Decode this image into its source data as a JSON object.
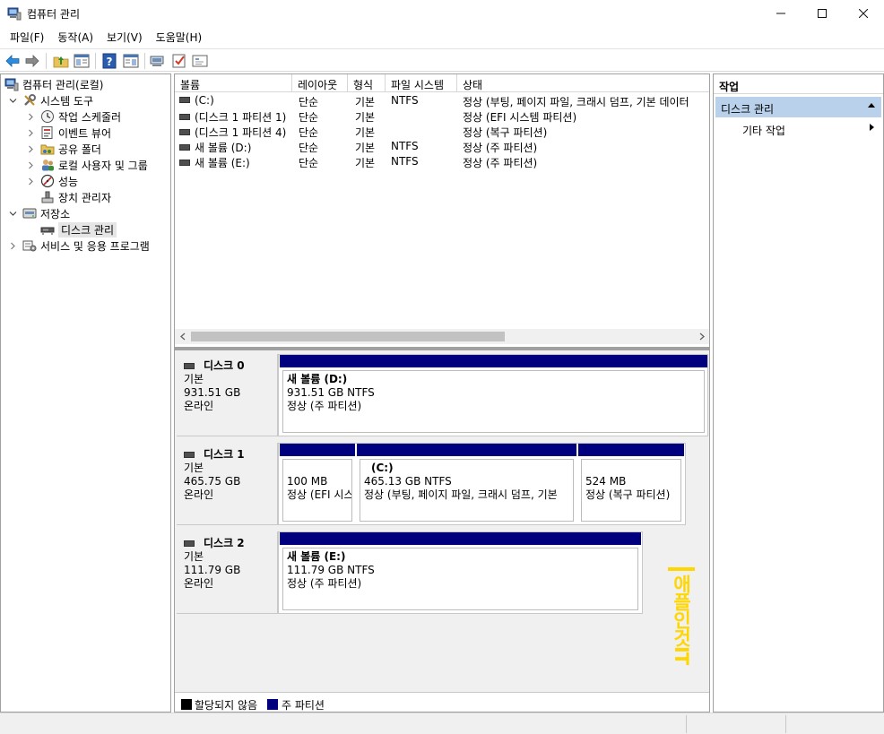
{
  "window": {
    "title": "컴퓨터 관리"
  },
  "menu": [
    {
      "label": "파일(F)"
    },
    {
      "label": "동작(A)"
    },
    {
      "label": "보기(V)"
    },
    {
      "label": "도움말(H)"
    }
  ],
  "toolbar": {
    "icons": [
      "back-icon",
      "forward-icon",
      "up-folder-icon",
      "show-hide-tree-icon",
      "help-icon",
      "properties-icon",
      "connect-icon",
      "check-icon",
      "console-icon"
    ]
  },
  "tree": {
    "root": "컴퓨터 관리(로컬)",
    "system_tools": "시스템 도구",
    "task_scheduler": "작업 스케줄러",
    "event_viewer": "이벤트 뷰어",
    "shared_folders": "공유 폴더",
    "local_users": "로컬 사용자 및 그룹",
    "performance": "성능",
    "device_manager": "장치 관리자",
    "storage": "저장소",
    "disk_management": "디스크 관리",
    "services": "서비스 및 응용 프로그램"
  },
  "volumes": {
    "headers": [
      "볼륨",
      "레이아웃",
      "형식",
      "파일 시스템",
      "상태"
    ],
    "rows": [
      {
        "volume": "(C:)",
        "layout": "단순",
        "type": "기본",
        "fs": "NTFS",
        "status": "정상 (부팅, 페이지 파일, 크래시 덤프, 기본 데이터"
      },
      {
        "volume": "(디스크 1 파티션 1)",
        "layout": "단순",
        "type": "기본",
        "fs": "",
        "status": "정상 (EFI 시스템 파티션)"
      },
      {
        "volume": "(디스크 1 파티션 4)",
        "layout": "단순",
        "type": "기본",
        "fs": "",
        "status": "정상 (복구 파티션)"
      },
      {
        "volume": "새 볼륨 (D:)",
        "layout": "단순",
        "type": "기본",
        "fs": "NTFS",
        "status": "정상 (주 파티션)"
      },
      {
        "volume": "새 볼륨 (E:)",
        "layout": "단순",
        "type": "기본",
        "fs": "NTFS",
        "status": "정상 (주 파티션)"
      }
    ]
  },
  "disks": [
    {
      "name": "디스크 0",
      "kind": "기본",
      "size": "931.51 GB",
      "state": "온라인",
      "partitions": [
        {
          "name": "새 볼륨  (D:)",
          "size": "931.51 GB NTFS",
          "status": "정상 (주 파티션)"
        }
      ]
    },
    {
      "name": "디스크 1",
      "kind": "기본",
      "size": "465.75 GB",
      "state": "온라인",
      "partitions": [
        {
          "name": "",
          "size": "100 MB",
          "status": "정상 (EFI 시스"
        },
        {
          "name": "(C:)",
          "size": "465.13 GB NTFS",
          "status": "정상 (부팅, 페이지 파일, 크래시 덤프, 기본"
        },
        {
          "name": "",
          "size": "524 MB",
          "status": "정상 (복구 파티션)"
        }
      ]
    },
    {
      "name": "디스크 2",
      "kind": "기본",
      "size": "111.79 GB",
      "state": "온라인",
      "partitions": [
        {
          "name": "새 볼륨  (E:)",
          "size": "111.79 GB NTFS",
          "status": "정상 (주 파티션)"
        }
      ]
    }
  ],
  "legend": [
    {
      "label": "할당되지 않음",
      "color": "#000000"
    },
    {
      "label": "주 파티션",
      "color": "#00007f"
    }
  ],
  "watermark": {
    "text": "애플인것IT"
  },
  "actions": {
    "title": "작업",
    "section": "디스크 관리",
    "more": "기타 작업"
  }
}
